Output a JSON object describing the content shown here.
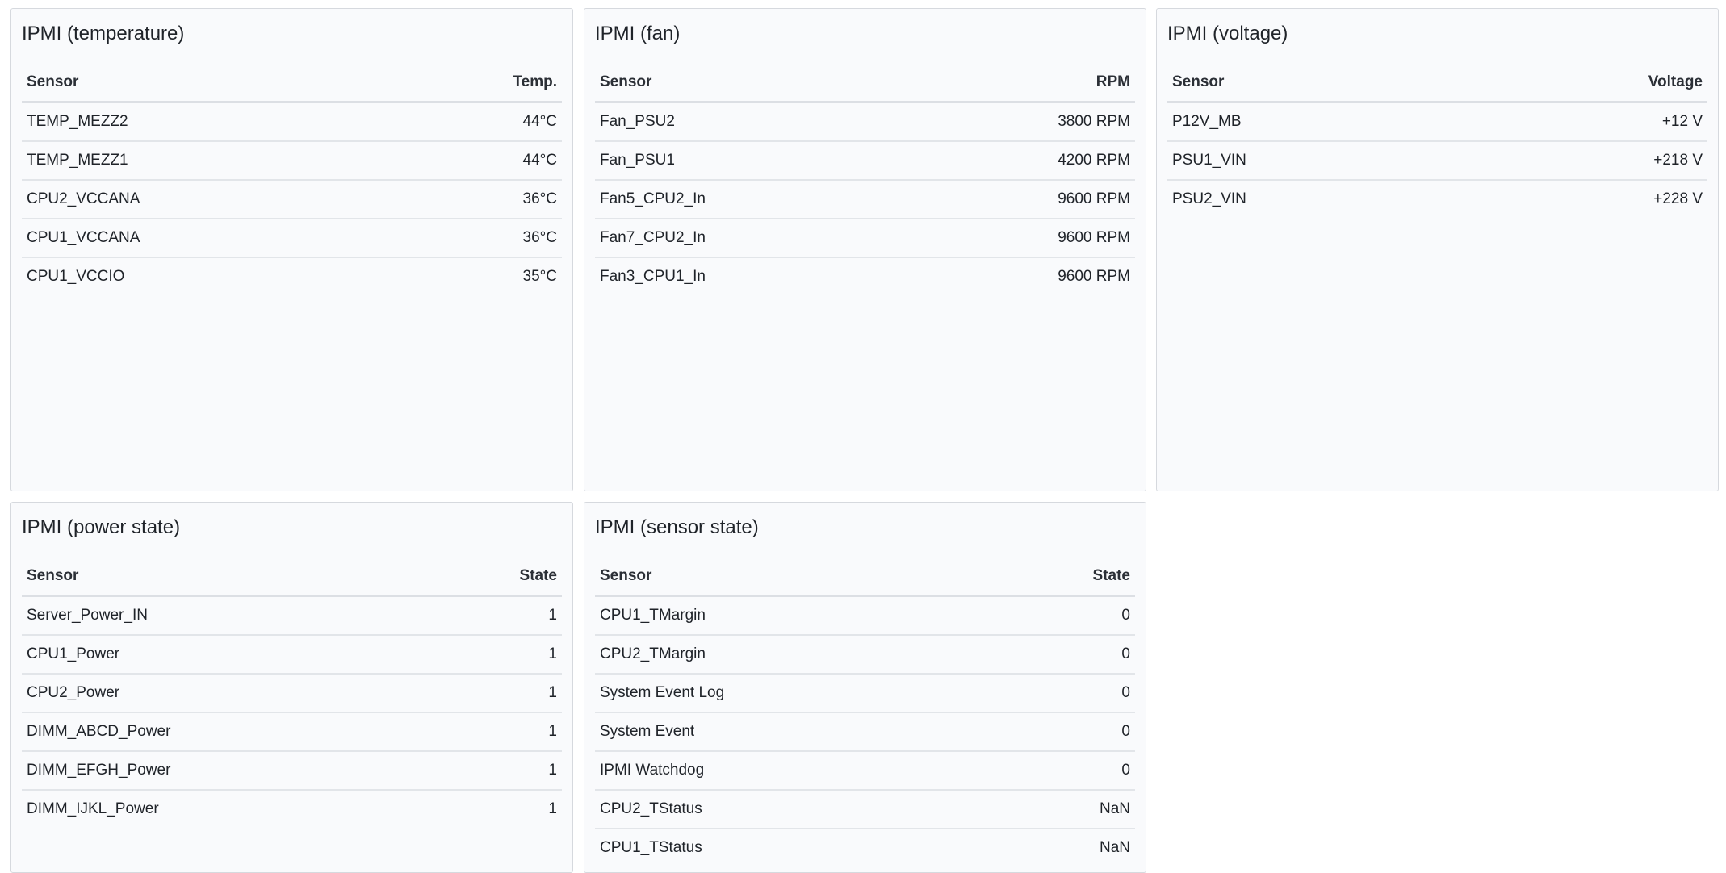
{
  "panels": {
    "temperature": {
      "title": "IPMI (temperature)",
      "headers": [
        "Sensor",
        "Temp."
      ],
      "rows": [
        [
          "TEMP_MEZZ2",
          "44°C"
        ],
        [
          "TEMP_MEZZ1",
          "44°C"
        ],
        [
          "CPU2_VCCANA",
          "36°C"
        ],
        [
          "CPU1_VCCANA",
          "36°C"
        ],
        [
          "CPU1_VCCIO",
          "35°C"
        ]
      ]
    },
    "fan": {
      "title": "IPMI (fan)",
      "headers": [
        "Sensor",
        "RPM"
      ],
      "rows": [
        [
          "Fan_PSU2",
          "3800 RPM"
        ],
        [
          "Fan_PSU1",
          "4200 RPM"
        ],
        [
          "Fan5_CPU2_In",
          "9600 RPM"
        ],
        [
          "Fan7_CPU2_In",
          "9600 RPM"
        ],
        [
          "Fan3_CPU1_In",
          "9600 RPM"
        ]
      ]
    },
    "voltage": {
      "title": "IPMI (voltage)",
      "headers": [
        "Sensor",
        "Voltage"
      ],
      "rows": [
        [
          "P12V_MB",
          "+12 V"
        ],
        [
          "PSU1_VIN",
          "+218 V"
        ],
        [
          "PSU2_VIN",
          "+228 V"
        ]
      ]
    },
    "power_state": {
      "title": "IPMI (power state)",
      "headers": [
        "Sensor",
        "State"
      ],
      "rows": [
        [
          "Server_Power_IN",
          "1"
        ],
        [
          "CPU1_Power",
          "1"
        ],
        [
          "CPU2_Power",
          "1"
        ],
        [
          "DIMM_ABCD_Power",
          "1"
        ],
        [
          "DIMM_EFGH_Power",
          "1"
        ],
        [
          "DIMM_IJKL_Power",
          "1"
        ]
      ]
    },
    "sensor_state": {
      "title": "IPMI (sensor state)",
      "headers": [
        "Sensor",
        "State"
      ],
      "rows": [
        [
          "CPU1_TMargin",
          "0"
        ],
        [
          "CPU2_TMargin",
          "0"
        ],
        [
          "System Event Log",
          "0"
        ],
        [
          "System Event",
          "0"
        ],
        [
          "IPMI Watchdog",
          "0"
        ],
        [
          "CPU2_TStatus",
          "NaN"
        ],
        [
          "CPU1_TStatus",
          "NaN"
        ]
      ]
    }
  }
}
